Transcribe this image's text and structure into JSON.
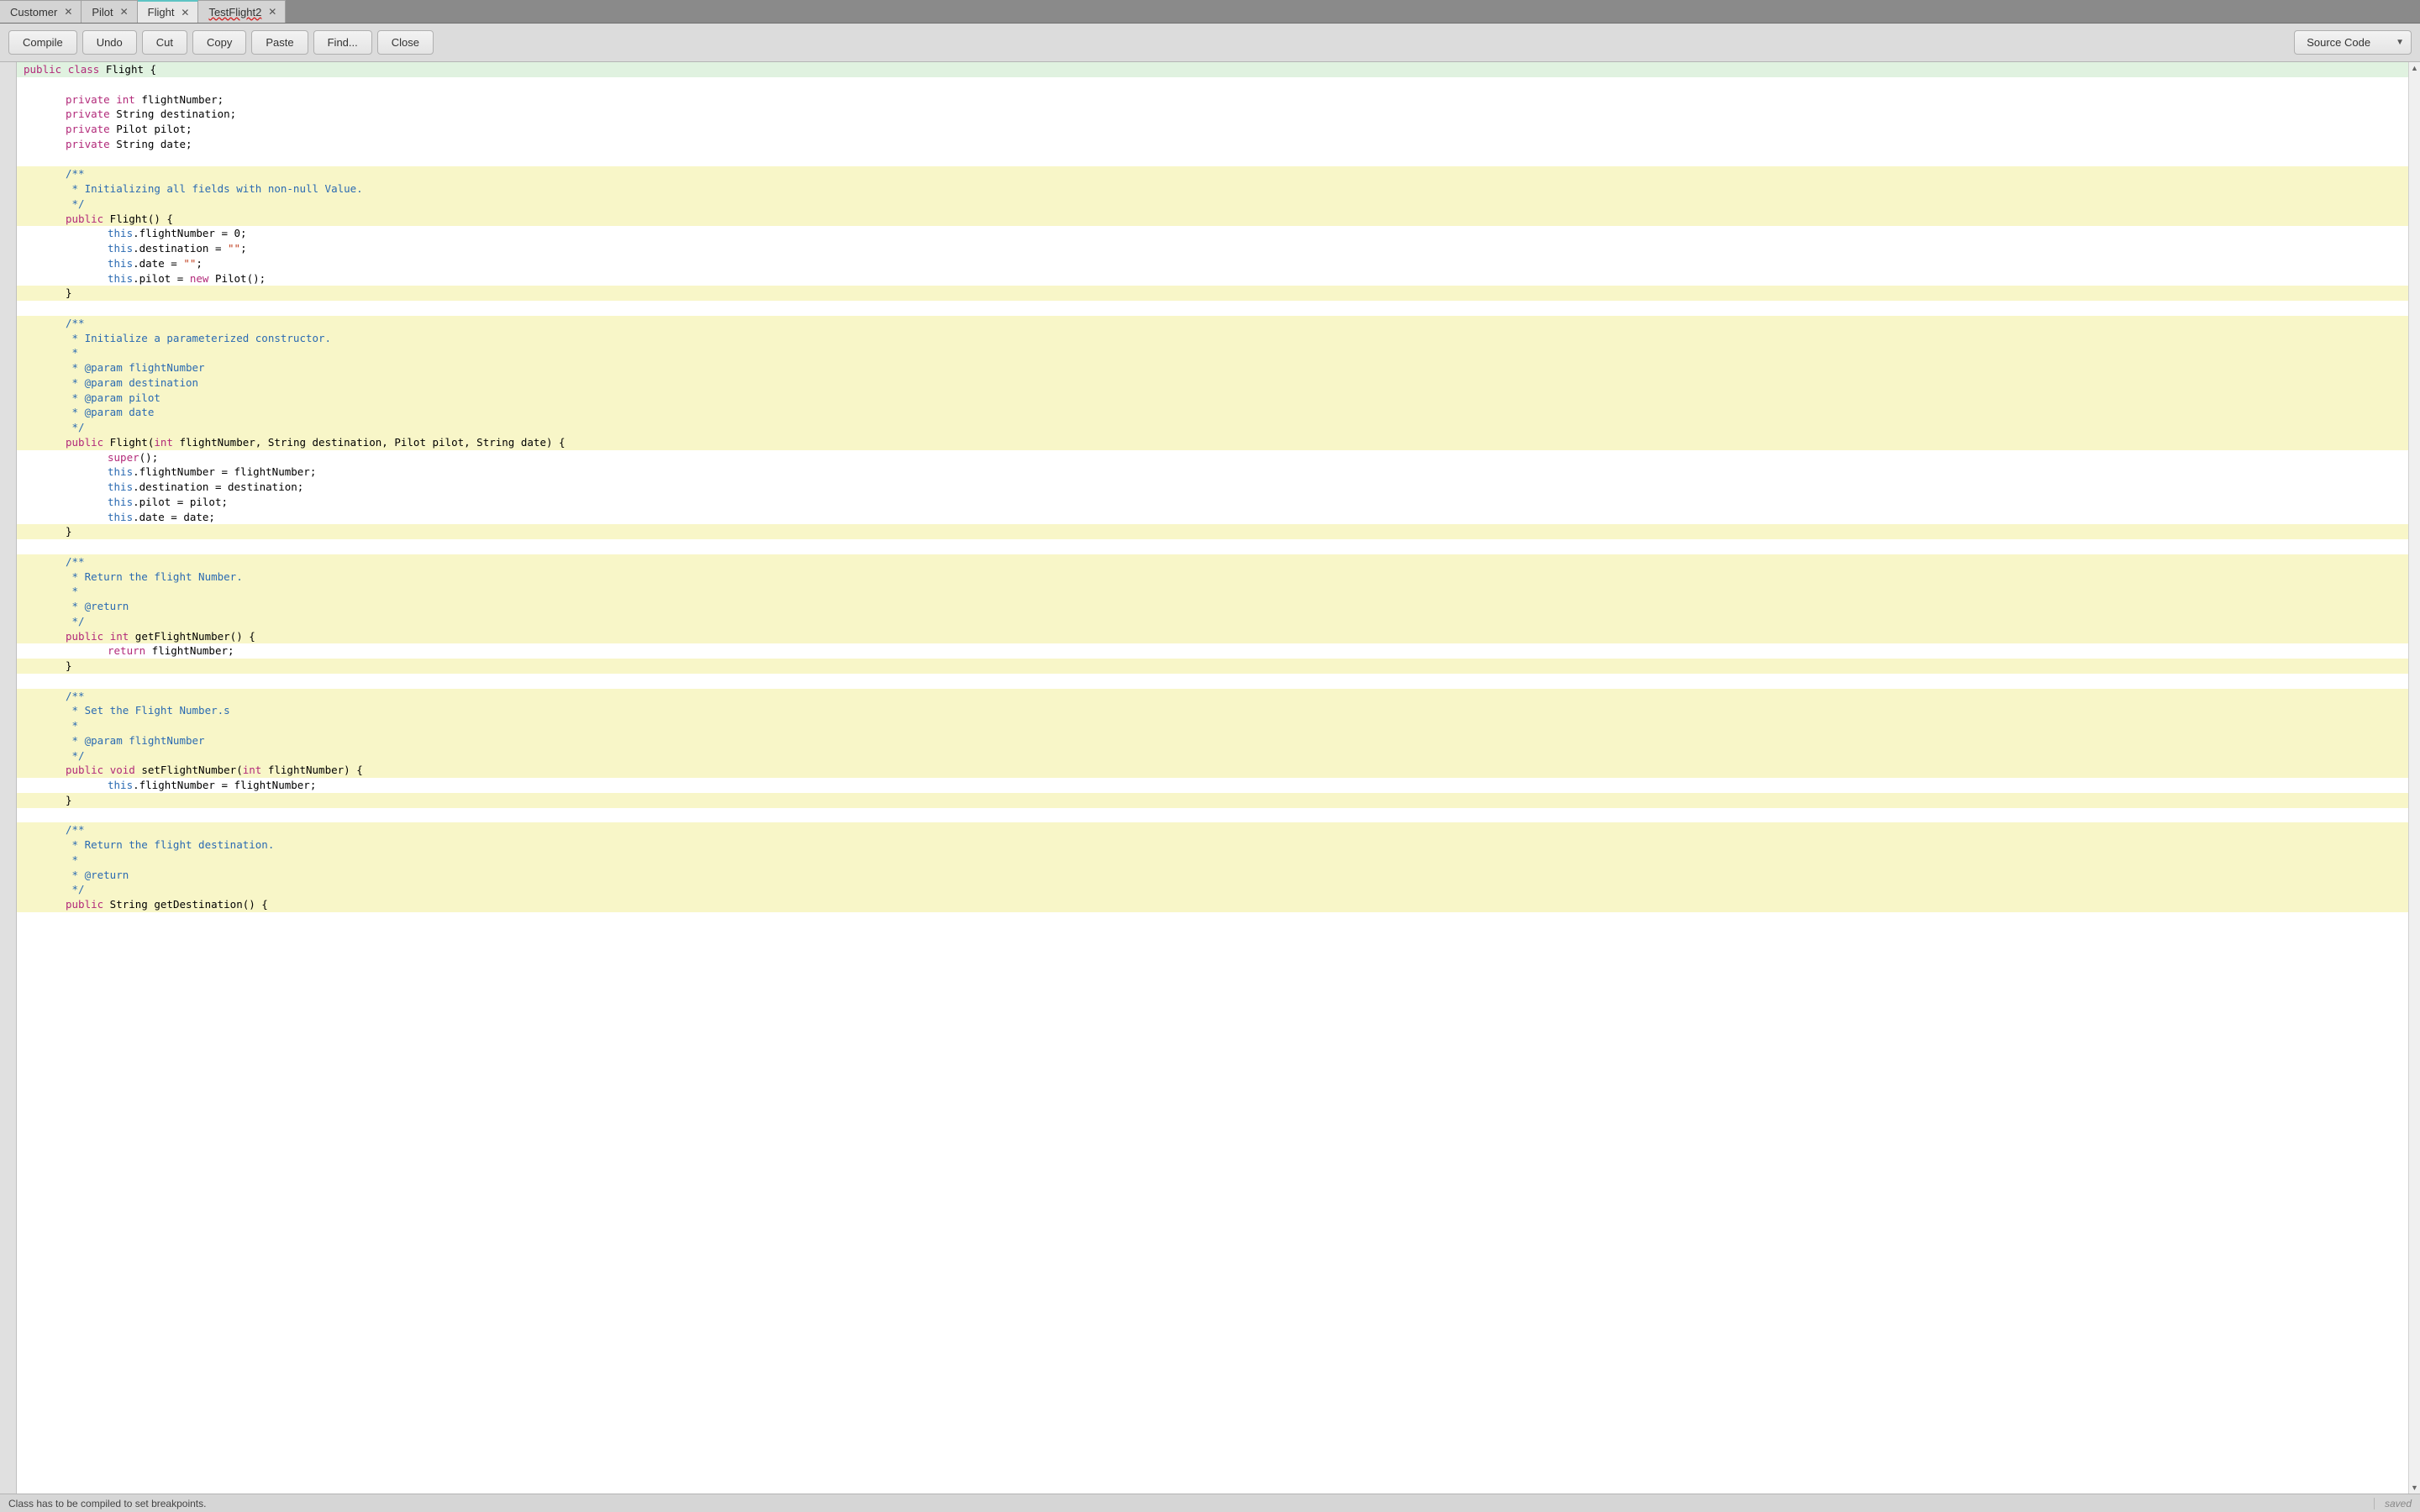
{
  "tabs": [
    {
      "label": "Customer",
      "active": false,
      "error": false
    },
    {
      "label": "Pilot",
      "active": false,
      "error": false
    },
    {
      "label": "Flight",
      "active": true,
      "error": false
    },
    {
      "label": "TestFlight2",
      "active": false,
      "error": true
    }
  ],
  "toolbar": {
    "compile": "Compile",
    "undo": "Undo",
    "cut": "Cut",
    "copy": "Copy",
    "paste": "Paste",
    "find": "Find...",
    "close": "Close",
    "view": "Source Code"
  },
  "status": {
    "left": "Class has to be compiled to set breakpoints.",
    "right": "saved"
  },
  "code": [
    {
      "bg": "decl",
      "indent": 0,
      "tokens": [
        [
          "mod",
          "public"
        ],
        [
          "",
          ""
        ],
        [
          "key",
          "class"
        ],
        [
          "",
          " Flight {"
        ]
      ]
    },
    {
      "bg": "body",
      "indent": 0,
      "tokens": [
        [
          "",
          ""
        ]
      ]
    },
    {
      "bg": "body",
      "indent": 1,
      "tokens": [
        [
          "mod",
          "private"
        ],
        [
          "",
          " "
        ],
        [
          "type",
          "int"
        ],
        [
          "",
          " flightNumber;"
        ]
      ]
    },
    {
      "bg": "body",
      "indent": 1,
      "tokens": [
        [
          "mod",
          "private"
        ],
        [
          "",
          " String destination;"
        ]
      ]
    },
    {
      "bg": "body",
      "indent": 1,
      "tokens": [
        [
          "mod",
          "private"
        ],
        [
          "",
          " Pilot pilot;"
        ]
      ]
    },
    {
      "bg": "body",
      "indent": 1,
      "tokens": [
        [
          "mod",
          "private"
        ],
        [
          "",
          " String date;"
        ]
      ]
    },
    {
      "bg": "body",
      "indent": 0,
      "tokens": [
        [
          "",
          ""
        ]
      ]
    },
    {
      "bg": "doc",
      "indent": 1,
      "tokens": [
        [
          "doc",
          "/**"
        ]
      ]
    },
    {
      "bg": "doc",
      "indent": 1,
      "tokens": [
        [
          "doc",
          " * Initializing all fields with non-null Value."
        ]
      ]
    },
    {
      "bg": "doc",
      "indent": 1,
      "tokens": [
        [
          "doc",
          " */"
        ]
      ]
    },
    {
      "bg": "doc",
      "indent": 1,
      "tokens": [
        [
          "mod",
          "public"
        ],
        [
          "",
          " Flight() {"
        ]
      ]
    },
    {
      "bg": "body",
      "indent": 2,
      "tokens": [
        [
          "this",
          "this"
        ],
        [
          "",
          ".flightNumber = 0;"
        ]
      ]
    },
    {
      "bg": "body",
      "indent": 2,
      "tokens": [
        [
          "this",
          "this"
        ],
        [
          "",
          ".destination = "
        ],
        [
          "str",
          "\"\""
        ],
        [
          "",
          ";"
        ]
      ]
    },
    {
      "bg": "body",
      "indent": 2,
      "tokens": [
        [
          "this",
          "this"
        ],
        [
          "",
          ".date = "
        ],
        [
          "str",
          "\"\""
        ],
        [
          "",
          ";"
        ]
      ]
    },
    {
      "bg": "body",
      "indent": 2,
      "tokens": [
        [
          "this",
          "this"
        ],
        [
          "",
          ".pilot = "
        ],
        [
          "key",
          "new"
        ],
        [
          "",
          " Pilot();"
        ]
      ]
    },
    {
      "bg": "doc",
      "indent": 1,
      "tokens": [
        [
          "",
          "}"
        ]
      ]
    },
    {
      "bg": "body",
      "indent": 0,
      "tokens": [
        [
          "",
          ""
        ]
      ]
    },
    {
      "bg": "doc",
      "indent": 1,
      "tokens": [
        [
          "doc",
          "/**"
        ]
      ]
    },
    {
      "bg": "doc",
      "indent": 1,
      "tokens": [
        [
          "doc",
          " * Initialize a parameterized constructor."
        ]
      ]
    },
    {
      "bg": "doc",
      "indent": 1,
      "tokens": [
        [
          "doc",
          " *"
        ]
      ]
    },
    {
      "bg": "doc",
      "indent": 1,
      "tokens": [
        [
          "doc",
          " * @param flightNumber"
        ]
      ]
    },
    {
      "bg": "doc",
      "indent": 1,
      "tokens": [
        [
          "doc",
          " * @param destination"
        ]
      ]
    },
    {
      "bg": "doc",
      "indent": 1,
      "tokens": [
        [
          "doc",
          " * @param pilot"
        ]
      ]
    },
    {
      "bg": "doc",
      "indent": 1,
      "tokens": [
        [
          "doc",
          " * @param date"
        ]
      ]
    },
    {
      "bg": "doc",
      "indent": 1,
      "tokens": [
        [
          "doc",
          " */"
        ]
      ]
    },
    {
      "bg": "doc",
      "indent": 1,
      "tokens": [
        [
          "mod",
          "public"
        ],
        [
          "",
          " Flight("
        ],
        [
          "type",
          "int"
        ],
        [
          "",
          " flightNumber, String destination, Pilot pilot, String date) {"
        ]
      ]
    },
    {
      "bg": "body",
      "indent": 2,
      "tokens": [
        [
          "key",
          "super"
        ],
        [
          "",
          "();"
        ]
      ]
    },
    {
      "bg": "body",
      "indent": 2,
      "tokens": [
        [
          "this",
          "this"
        ],
        [
          "",
          ".flightNumber = flightNumber;"
        ]
      ]
    },
    {
      "bg": "body",
      "indent": 2,
      "tokens": [
        [
          "this",
          "this"
        ],
        [
          "",
          ".destination = destination;"
        ]
      ]
    },
    {
      "bg": "body",
      "indent": 2,
      "tokens": [
        [
          "this",
          "this"
        ],
        [
          "",
          ".pilot = pilot;"
        ]
      ]
    },
    {
      "bg": "body",
      "indent": 2,
      "tokens": [
        [
          "this",
          "this"
        ],
        [
          "",
          ".date = date;"
        ]
      ]
    },
    {
      "bg": "doc",
      "indent": 1,
      "tokens": [
        [
          "",
          "}"
        ]
      ]
    },
    {
      "bg": "body",
      "indent": 0,
      "tokens": [
        [
          "",
          ""
        ]
      ]
    },
    {
      "bg": "doc",
      "indent": 1,
      "tokens": [
        [
          "doc",
          "/**"
        ]
      ]
    },
    {
      "bg": "doc",
      "indent": 1,
      "tokens": [
        [
          "doc",
          " * Return the flight Number."
        ]
      ]
    },
    {
      "bg": "doc",
      "indent": 1,
      "tokens": [
        [
          "doc",
          " *"
        ]
      ]
    },
    {
      "bg": "doc",
      "indent": 1,
      "tokens": [
        [
          "doc",
          " * @return"
        ]
      ]
    },
    {
      "bg": "doc",
      "indent": 1,
      "tokens": [
        [
          "doc",
          " */"
        ]
      ]
    },
    {
      "bg": "doc",
      "indent": 1,
      "tokens": [
        [
          "mod",
          "public"
        ],
        [
          "",
          " "
        ],
        [
          "type",
          "int"
        ],
        [
          "",
          " getFlightNumber() {"
        ]
      ]
    },
    {
      "bg": "body",
      "indent": 2,
      "tokens": [
        [
          "key",
          "return"
        ],
        [
          "",
          " flightNumber;"
        ]
      ]
    },
    {
      "bg": "doc",
      "indent": 1,
      "tokens": [
        [
          "",
          "}"
        ]
      ]
    },
    {
      "bg": "body",
      "indent": 0,
      "tokens": [
        [
          "",
          ""
        ]
      ]
    },
    {
      "bg": "doc",
      "indent": 1,
      "tokens": [
        [
          "doc",
          "/**"
        ]
      ]
    },
    {
      "bg": "doc",
      "indent": 1,
      "tokens": [
        [
          "doc",
          " * Set the Flight Number.s"
        ]
      ]
    },
    {
      "bg": "doc",
      "indent": 1,
      "tokens": [
        [
          "doc",
          " *"
        ]
      ]
    },
    {
      "bg": "doc",
      "indent": 1,
      "tokens": [
        [
          "doc",
          " * @param flightNumber"
        ]
      ]
    },
    {
      "bg": "doc",
      "indent": 1,
      "tokens": [
        [
          "doc",
          " */"
        ]
      ]
    },
    {
      "bg": "doc",
      "indent": 1,
      "tokens": [
        [
          "mod",
          "public"
        ],
        [
          "",
          " "
        ],
        [
          "type",
          "void"
        ],
        [
          "",
          " setFlightNumber("
        ],
        [
          "type",
          "int"
        ],
        [
          "",
          " flightNumber) {"
        ]
      ]
    },
    {
      "bg": "body",
      "indent": 2,
      "tokens": [
        [
          "this",
          "this"
        ],
        [
          "",
          ".flightNumber = flightNumber;"
        ]
      ]
    },
    {
      "bg": "doc",
      "indent": 1,
      "tokens": [
        [
          "",
          "}"
        ]
      ]
    },
    {
      "bg": "body",
      "indent": 0,
      "tokens": [
        [
          "",
          ""
        ]
      ]
    },
    {
      "bg": "doc",
      "indent": 1,
      "tokens": [
        [
          "doc",
          "/**"
        ]
      ]
    },
    {
      "bg": "doc",
      "indent": 1,
      "tokens": [
        [
          "doc",
          " * Return the flight destination."
        ]
      ]
    },
    {
      "bg": "doc",
      "indent": 1,
      "tokens": [
        [
          "doc",
          " *"
        ]
      ]
    },
    {
      "bg": "doc",
      "indent": 1,
      "tokens": [
        [
          "doc",
          " * @return"
        ]
      ]
    },
    {
      "bg": "doc",
      "indent": 1,
      "tokens": [
        [
          "doc",
          " */"
        ]
      ]
    },
    {
      "bg": "doc",
      "indent": 1,
      "tokens": [
        [
          "mod",
          "public"
        ],
        [
          "",
          " String getDestination() {"
        ]
      ]
    }
  ]
}
